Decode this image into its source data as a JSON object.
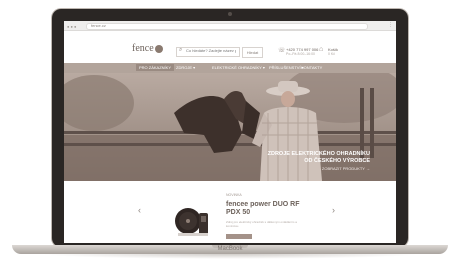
{
  "browser": {
    "url": "fence.cz"
  },
  "header": {
    "logo_text": "fence",
    "search_placeholder": "Co hledáte? Zadejte název produktu",
    "search_button": "Hledat",
    "phone": "+420 774 997 006",
    "phone_sub": "Po–Pá 8:00–16:00",
    "cart_label": "Košík",
    "cart_sub": "0 Kč"
  },
  "nav": {
    "items": [
      {
        "label": "PRO ZÁKAZNÍKY"
      },
      {
        "label": "ZDROJE ▾"
      },
      {
        "label": "ELEKTRICKÉ OHRADNÍKY ▾"
      },
      {
        "label": "PŘÍSLUŠENSTVÍ ▾"
      },
      {
        "label": "KONTAKTY"
      }
    ]
  },
  "hero": {
    "title_line1": "ZDROJE ELEKTRICKÉHO OHRADNÍKU",
    "title_line2": "OD ČESKÉHO VÝROBCE",
    "subtitle": "ZOBRAZIT PRODUKTY →"
  },
  "product": {
    "badge": "NOVINKA",
    "title_line1": "fencee power DUO RF",
    "title_line2": "PDX 50",
    "description": "Zdroj pro elektrický ohradník s dálkovým ovládáním a kontrolou.",
    "prev_arrow": "‹",
    "next_arrow": "›"
  },
  "device_brand": "MacBook",
  "colors": {
    "nav": "#b2a49b",
    "hero_tint": "#9d8d84",
    "accent": "#a49289"
  }
}
